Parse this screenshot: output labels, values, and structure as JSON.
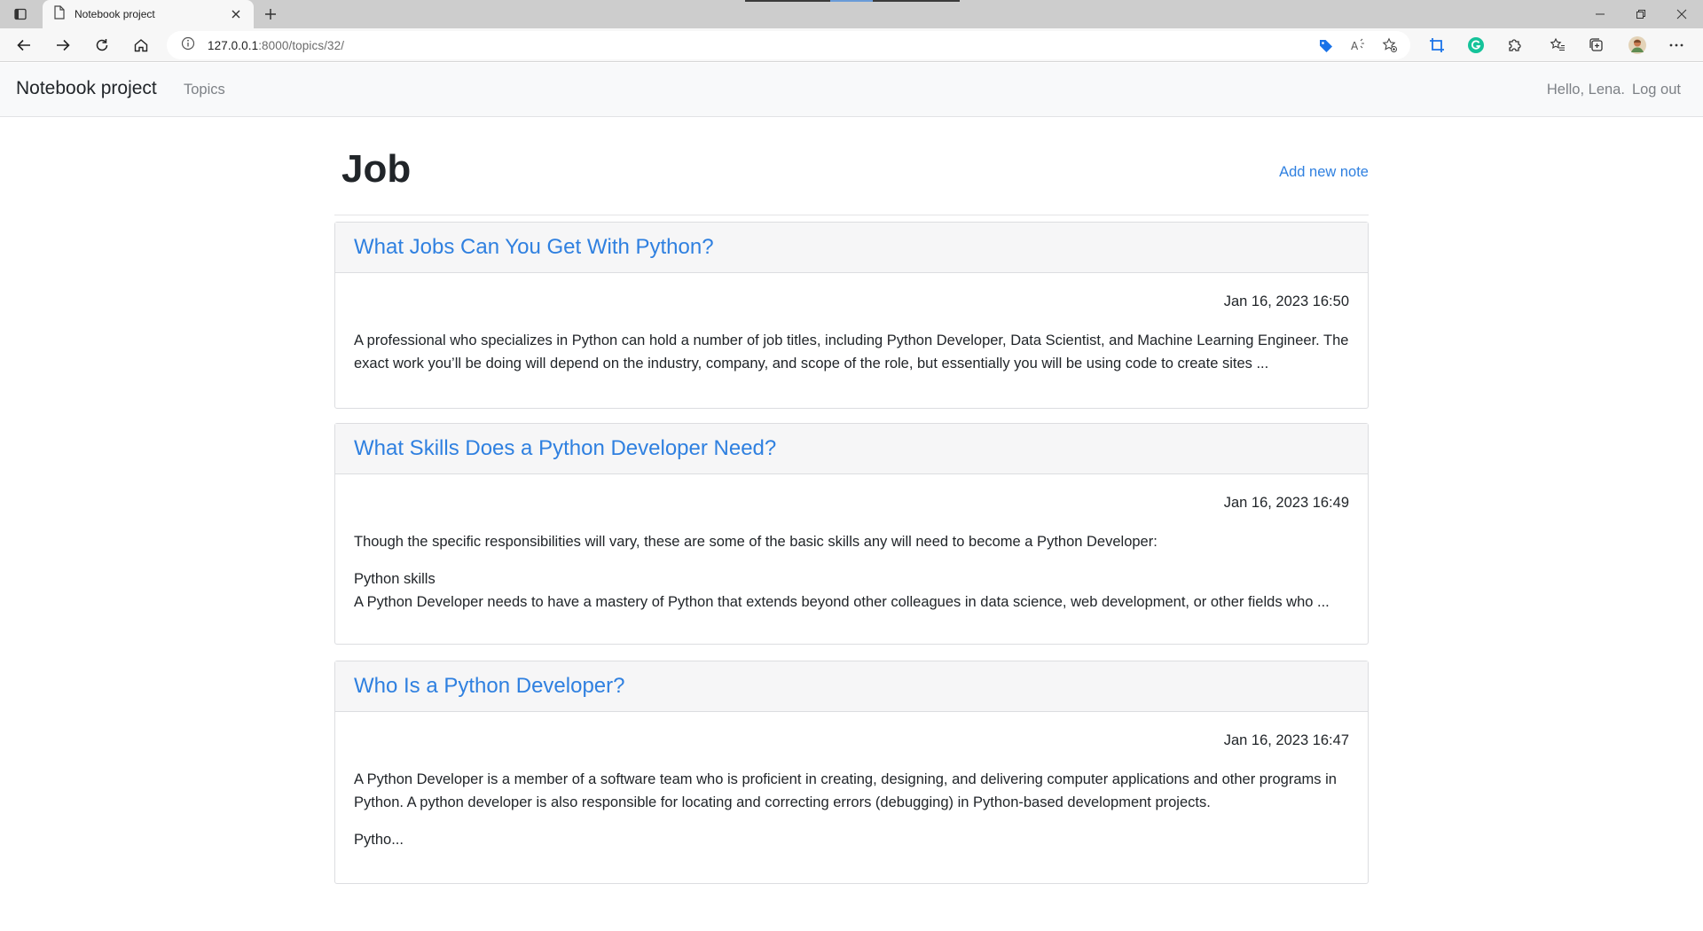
{
  "browser": {
    "tab_title": "Notebook project",
    "url_host": "127.0.0.1",
    "url_path": ":8000/topics/32/",
    "icons": {
      "tab_actions": "tab-actions-icon",
      "page": "page-icon",
      "close": "close-icon",
      "new_tab": "plus-icon",
      "back": "back-arrow-icon",
      "forward": "forward-arrow-icon",
      "reload": "reload-icon",
      "home": "home-icon",
      "info": "info-icon",
      "tag": "tag-icon",
      "read_aloud": "read-aloud-icon",
      "favorite_add": "star-add-icon",
      "crop": "crop-icon",
      "grammarly": "grammarly-icon",
      "extensions": "puzzle-icon",
      "favorites": "favorites-icon",
      "collections": "collections-icon",
      "profile": "profile-avatar-icon",
      "more": "more-icon",
      "minimize": "minimize-icon",
      "restore": "restore-icon",
      "close_window": "close-window-icon"
    }
  },
  "navbar": {
    "brand": "Notebook project",
    "topics_link": "Topics",
    "greeting": "Hello, Lena.",
    "logout": "Log out"
  },
  "page": {
    "title": "Job",
    "add_note": "Add new note"
  },
  "notes": [
    {
      "title": "What Jobs Can You Get With Python?",
      "date": "Jan 16, 2023 16:50",
      "paragraphs": [
        "A professional who specializes in Python can hold a number of job titles, including Python Developer, Data Scientist, and Machine Learning Engineer. The exact work you’ll be doing will depend on the industry, company, and scope of the role, but essentially you will be using code to create sites ..."
      ]
    },
    {
      "title": "What Skills Does a Python Developer Need?",
      "date": "Jan 16, 2023 16:49",
      "paragraphs": [
        "Though the specific responsibilities will vary, these are some of the basic skills any will need to become a Python Developer:",
        "Python skills",
        "A Python Developer needs to have a mastery of Python that extends beyond other colleagues in data science, web development, or other fields who ..."
      ]
    },
    {
      "title": "Who Is a Python Developer?",
      "date": "Jan 16, 2023 16:47",
      "paragraphs": [
        "A Python Developer is a member of a software team who is proficient in creating, designing, and delivering computer applications and other programs in Python. A python developer is also responsible for locating and correcting errors (debugging) in Python-based development projects.",
        "Pytho..."
      ]
    }
  ],
  "colors": {
    "link": "#2f80e0",
    "navbar_bg": "#f8f9fa",
    "card_header_bg": "#f6f6f7",
    "text": "#212529",
    "muted": "#7d8186"
  }
}
